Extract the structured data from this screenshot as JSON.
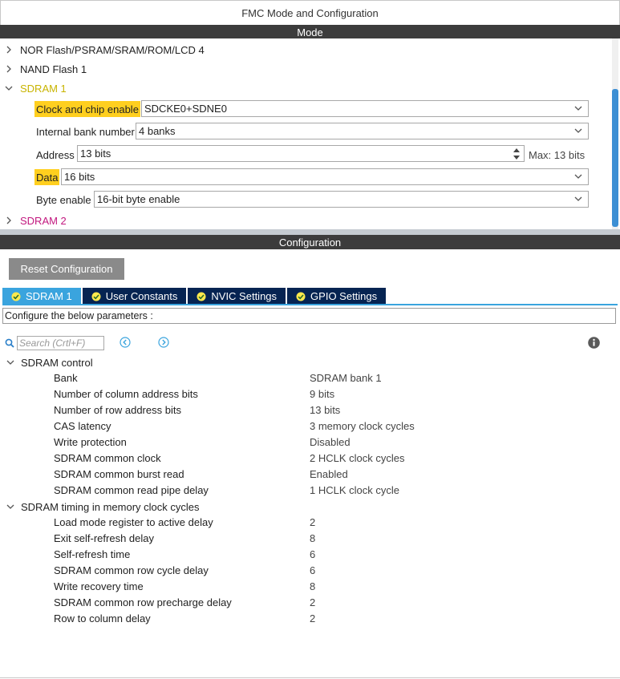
{
  "window": {
    "title": "FMC Mode and Configuration"
  },
  "mode": {
    "header": "Mode",
    "items": [
      {
        "label": "NOR Flash/PSRAM/SRAM/ROM/LCD 4",
        "color": "#333333",
        "expanded": false
      },
      {
        "label": "NAND Flash 1",
        "color": "#333333",
        "expanded": false
      },
      {
        "label": "SDRAM 1",
        "color": "#c8b400",
        "expanded": true
      },
      {
        "label": "SDRAM 2",
        "color": "#c2187f",
        "expanded": false
      }
    ],
    "params": {
      "clock": {
        "label": "Clock and chip enable",
        "value": "SDCKE0+SDNE0"
      },
      "banks": {
        "label": "Internal bank number",
        "value": "4 banks"
      },
      "address": {
        "label": "Address",
        "value": "13 bits",
        "max": "Max: 13 bits"
      },
      "data": {
        "label": "Data",
        "value": "16 bits"
      },
      "byte": {
        "label": "Byte enable",
        "value": "16-bit byte enable"
      }
    }
  },
  "configuration": {
    "header": "Configuration",
    "reset_label": "Reset Configuration",
    "tabs": [
      {
        "label": "SDRAM 1",
        "active": true
      },
      {
        "label": "User Constants",
        "active": false
      },
      {
        "label": "NVIC Settings",
        "active": false
      },
      {
        "label": "GPIO Settings",
        "active": false
      }
    ],
    "instruction": "Configure the below parameters :",
    "search_placeholder": "Search (Crtl+F)",
    "groups": [
      {
        "title": "SDRAM control",
        "rows": [
          {
            "name": "Bank",
            "value": "SDRAM bank 1"
          },
          {
            "name": "Number of column address bits",
            "value": "9 bits"
          },
          {
            "name": "Number of row address bits",
            "value": "13 bits"
          },
          {
            "name": "CAS latency",
            "value": "3 memory clock cycles"
          },
          {
            "name": "Write protection",
            "value": "Disabled"
          },
          {
            "name": "SDRAM common clock",
            "value": "2 HCLK clock cycles"
          },
          {
            "name": "SDRAM common burst read",
            "value": "Enabled"
          },
          {
            "name": "SDRAM common read pipe delay",
            "value": "1 HCLK clock cycle"
          }
        ]
      },
      {
        "title": "SDRAM timing in memory clock cycles",
        "rows": [
          {
            "name": "Load mode register to active delay",
            "value": "2"
          },
          {
            "name": "Exit self-refresh delay",
            "value": "8"
          },
          {
            "name": "Self-refresh time",
            "value": "6"
          },
          {
            "name": "SDRAM common row cycle delay",
            "value": "6"
          },
          {
            "name": "Write recovery time",
            "value": "8"
          },
          {
            "name": "SDRAM common row precharge delay",
            "value": "2"
          },
          {
            "name": "Row to column delay",
            "value": "2"
          }
        ]
      }
    ]
  },
  "colors": {
    "accent": "#3aa4de",
    "tab_dark": "#062452",
    "highlight": "#ffcf1f",
    "header_dark": "#3c3c3c"
  }
}
